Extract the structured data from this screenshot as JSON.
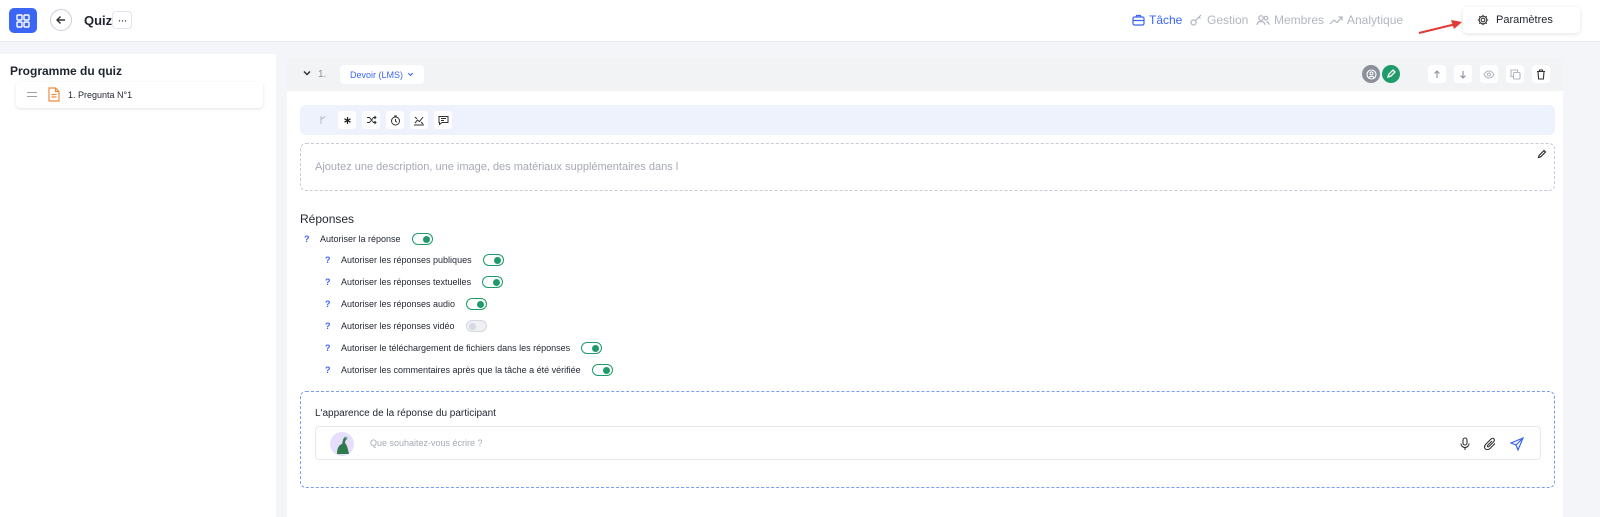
{
  "header": {
    "title": "Quiz",
    "more_label": "···",
    "nav": [
      {
        "label": "Tâche",
        "active": true
      },
      {
        "label": "Gestion",
        "active": false
      },
      {
        "label": "Membres",
        "active": false
      },
      {
        "label": "Analytique",
        "active": false
      }
    ],
    "settings_label": "Paramètres"
  },
  "sidebar": {
    "title": "Programme du quiz",
    "items": [
      {
        "label": "1. Pregunta N°1"
      }
    ]
  },
  "question": {
    "number": "1.",
    "type_label": "Devoir (LMS)",
    "description_placeholder": "Ajoutez une description, une image, des matériaux supplémentaires dans l",
    "responses_title": "Réponses",
    "qmark": "?",
    "options": [
      {
        "label": "Autoriser la réponse",
        "enabled": true
      },
      {
        "label": "Autoriser les réponses publiques",
        "enabled": true
      },
      {
        "label": "Autoriser les réponses textuelles",
        "enabled": true
      },
      {
        "label": "Autoriser les réponses audio",
        "enabled": true
      },
      {
        "label": "Autoriser les réponses vidéo",
        "enabled": false
      },
      {
        "label": "Autoriser le téléchargement de fichiers dans les réponses",
        "enabled": true
      },
      {
        "label": "Autoriser les commentaires après que la tâche a été vérifiée",
        "enabled": true
      }
    ],
    "preview_title": "L'apparence de la réponse du participant",
    "composer_placeholder": "Que souhaitez-vous écrire ?"
  },
  "colors": {
    "accent": "#3b66f5",
    "success": "#1f9b6a",
    "muted": "#b2b6c2",
    "annotation_arrow": "#e53935"
  }
}
